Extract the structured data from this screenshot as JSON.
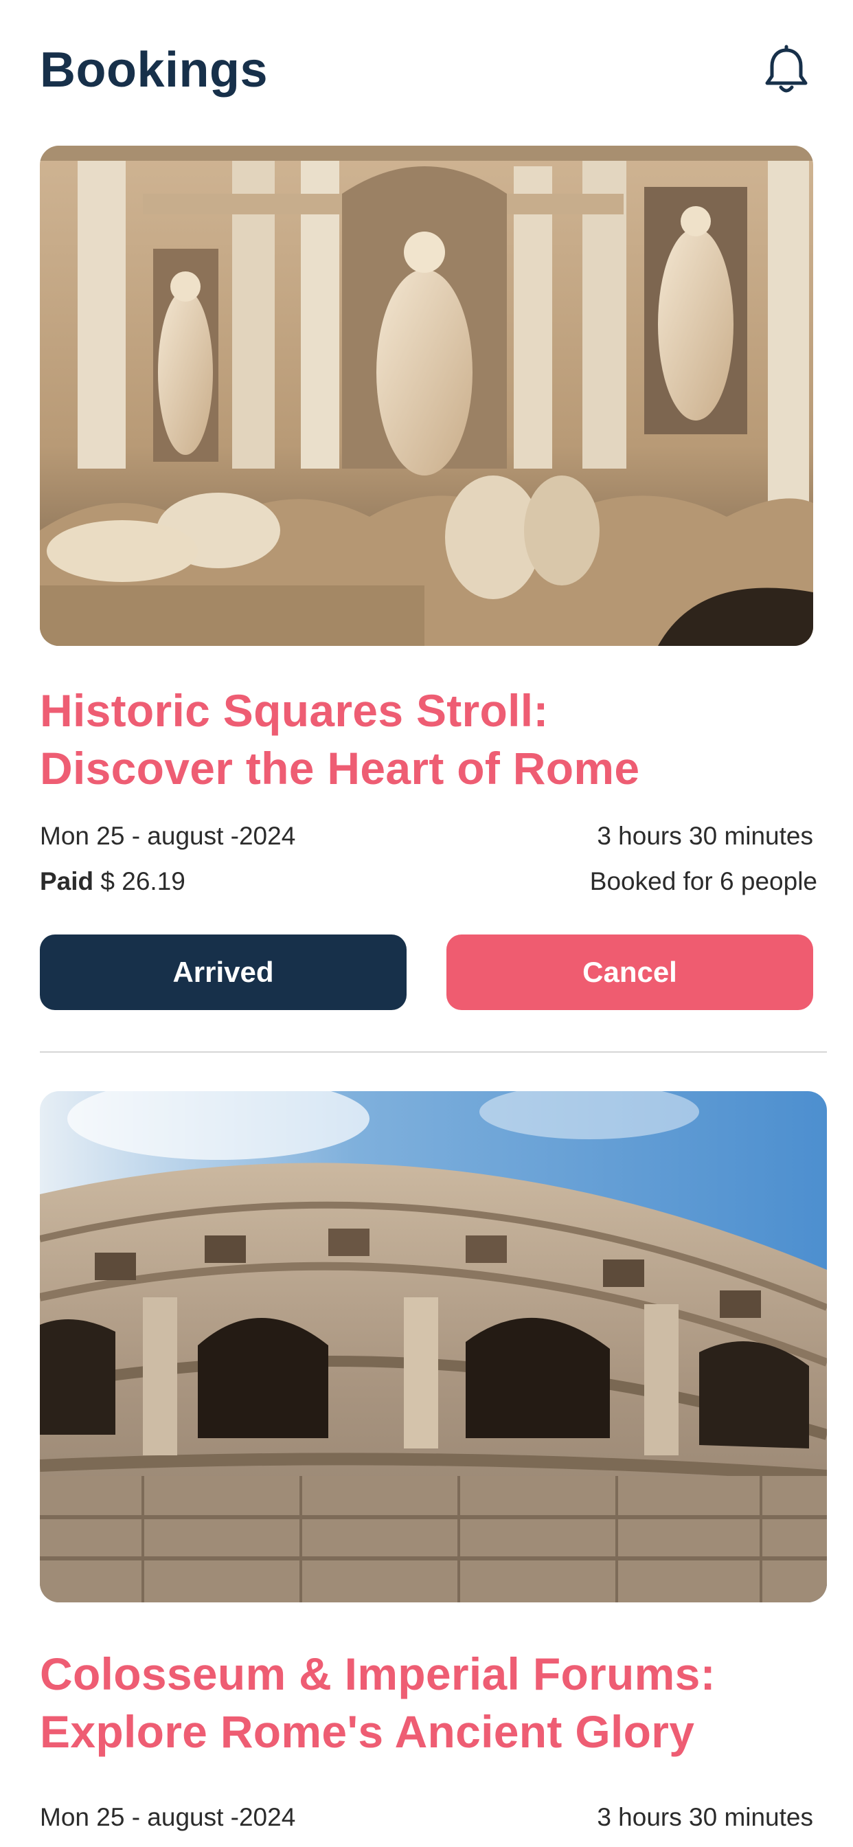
{
  "header": {
    "title": "Bookings",
    "icon": "bell-icon"
  },
  "bookings": [
    {
      "image": "trevi-fountain-photo",
      "title_line1": "Historic Squares Stroll:",
      "title_line2": "Discover the Heart of Rome",
      "date": "Mon 25 - august -2024",
      "duration": "3 hours 30 minutes",
      "paid_label": "Paid",
      "paid_amount": "$ 26.19",
      "people": "Booked for 6 people",
      "arrived_label": "Arrived",
      "cancel_label": "Cancel"
    },
    {
      "image": "colosseum-photo",
      "title_line1": "Colosseum & Imperial Forums:",
      "title_line2": "Explore Rome's Ancient Glory",
      "date": "Mon 25 - august -2024",
      "duration": "3 hours 30 minutes"
    }
  ],
  "colors": {
    "navy": "#17304a",
    "accent": "#ef5c70",
    "divider": "#d6d6d6"
  }
}
